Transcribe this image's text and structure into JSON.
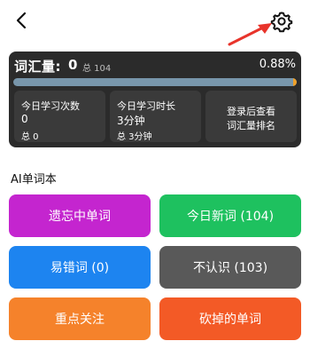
{
  "stats": {
    "vocab_label": "词汇量:",
    "vocab_count": "0",
    "vocab_total": "总 104",
    "vocab_percent": "0.88%",
    "progress_fraction": 0.0088,
    "tiles": [
      {
        "title": "今日学习次数",
        "value": "0",
        "sub": "总 0"
      },
      {
        "title": "今日学习时长",
        "value": "3分钟",
        "sub": "总 3分钟"
      },
      {
        "line1": "登录后查看",
        "line2": "词汇量排名"
      }
    ]
  },
  "section_title": "AI单词本",
  "buttons": [
    {
      "label": "遗忘中单词",
      "color": "#c425cf"
    },
    {
      "label": "今日新词 (104)",
      "color": "#1ec15f"
    },
    {
      "label": "易错词 (0)",
      "color": "#1d84f0"
    },
    {
      "label": "不认识 (103)",
      "color": "#595959"
    },
    {
      "label": "重点关注",
      "color": "#f5822b"
    },
    {
      "label": "砍掉的单词",
      "color": "#f35a26"
    }
  ],
  "colors": {
    "card_bg": "#2b2b2b",
    "progress_track": "#7896ab",
    "progress_fill": "#f0a12a",
    "annotation_arrow": "#e8342b"
  },
  "icons": [
    "back-icon",
    "gear-icon",
    "annotation-arrow"
  ]
}
